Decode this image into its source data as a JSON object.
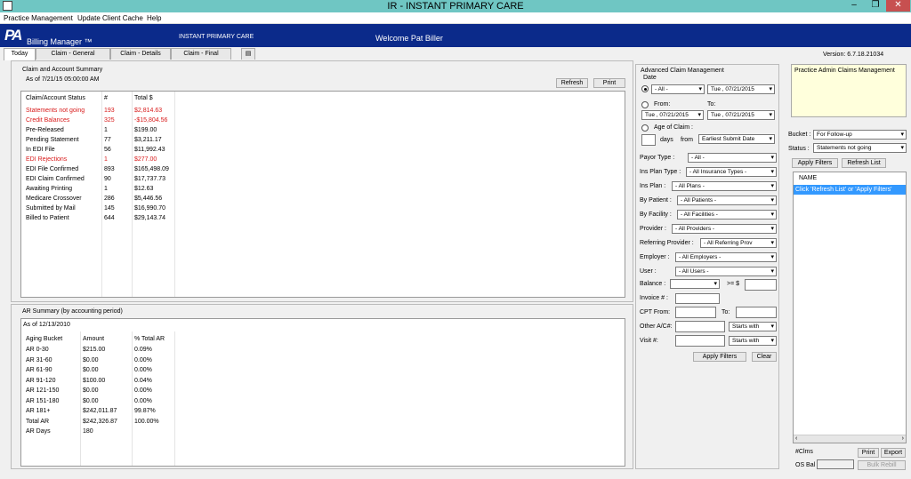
{
  "window": {
    "title": "IR - INSTANT PRIMARY CARE"
  },
  "menu": [
    "Practice Management",
    "Update Client Cache",
    "Help"
  ],
  "banner": {
    "logo": "PA",
    "app_name": "Billing Manager ™",
    "practice": "INSTANT PRIMARY CARE",
    "welcome": "Welcome Pat Biller"
  },
  "tabs": [
    "Today",
    "Claim - General",
    "Claim - Details",
    "Claim - Final"
  ],
  "version": "Version: 6.7.18.21034",
  "summary": {
    "title": "Claim and Account Summary",
    "as_of": "As of 7/21/15 05:00:00 AM",
    "refresh": "Refresh",
    "print": "Print",
    "headers": [
      "Claim/Account Status",
      "#",
      "Total $"
    ],
    "rows": [
      {
        "status": "Statements not going",
        "count": "193",
        "total": "$2,814.63",
        "red": true
      },
      {
        "status": "Credit Balances",
        "count": "325",
        "total": "-$15,804.56",
        "red": true
      },
      {
        "status": "Pre-Released",
        "count": "1",
        "total": "$199.00"
      },
      {
        "status": "Pending Statement",
        "count": "77",
        "total": "$3,211.17"
      },
      {
        "status": "In EDI File",
        "count": "56",
        "total": "$11,992.43"
      },
      {
        "status": "EDI Rejections",
        "count": "1",
        "total": "$277.00",
        "red": true
      },
      {
        "status": "EDI File Confirmed",
        "count": "893",
        "total": "$165,498.09"
      },
      {
        "status": "EDI Claim Confirmed",
        "count": "90",
        "total": "$17,737.73"
      },
      {
        "status": "Awaiting Printing",
        "count": "1",
        "total": "$12.63"
      },
      {
        "status": "Medicare Crossover",
        "count": "286",
        "total": "$5,446.56"
      },
      {
        "status": "Submitted by Mail",
        "count": "145",
        "total": "$16,990.70"
      },
      {
        "status": "Billed to Patient",
        "count": "644",
        "total": "$29,143.74"
      }
    ]
  },
  "ar": {
    "title": "AR Summary (by accounting period)",
    "as_of": "As of 12/13/2010",
    "headers": [
      "Aging Bucket",
      "Amount",
      "% Total AR"
    ],
    "rows": [
      {
        "bucket": "AR 0-30",
        "amount": "$215.00",
        "pct": "0.09%"
      },
      {
        "bucket": "AR 31-60",
        "amount": "$0.00",
        "pct": "0.00%"
      },
      {
        "bucket": "AR 61-90",
        "amount": "$0.00",
        "pct": "0.00%"
      },
      {
        "bucket": "AR 91-120",
        "amount": "$100.00",
        "pct": "0.04%"
      },
      {
        "bucket": "AR 121-150",
        "amount": "$0.00",
        "pct": "0.00%"
      },
      {
        "bucket": "AR 151-180",
        "amount": "$0.00",
        "pct": "0.00%"
      },
      {
        "bucket": "AR 181+",
        "amount": "$242,011.87",
        "pct": "99.87%"
      },
      {
        "bucket": "Total AR",
        "amount": "$242,326.87",
        "pct": "100.00%"
      },
      {
        "bucket": "AR Days",
        "amount": "180",
        "pct": ""
      }
    ]
  },
  "acm": {
    "title": "Advanced Claim Management",
    "date_label": "Date",
    "all": "- All -",
    "date1": "Tue , 07/21/2015",
    "from": "From:",
    "to": "To:",
    "from_date": "Tue , 07/21/2015",
    "to_date": "Tue , 07/21/2015",
    "age_label": "Age of Claim :",
    "days": "days",
    "from2": "from",
    "earliest": "Earliest Submit Date",
    "filters": [
      {
        "label": "Payor Type :",
        "value": "- All -"
      },
      {
        "label": "Ins Plan Type :",
        "value": "- All Insurance Types -"
      },
      {
        "label": "Ins Plan :",
        "value": "- All Plans -"
      },
      {
        "label": "By Patient :",
        "value": "- All Patients -"
      },
      {
        "label": "By Facility :",
        "value": "- All Facilities -"
      },
      {
        "label": "Provider :",
        "value": "- All Providers -"
      },
      {
        "label": "Referring Provider :",
        "value": "- All Referring Prov"
      },
      {
        "label": "Employer :",
        "value": "- All Employers -"
      },
      {
        "label": "User :",
        "value": "- All Users -"
      }
    ],
    "balance": "Balance :",
    "gte": ">= $",
    "invoice": "Invoice # :",
    "cpt_from": "CPT From:",
    "cpt_to": "To:",
    "other": "Other A/C#:",
    "visit": "Visit #:",
    "starts_with": "Starts with",
    "apply": "Apply Filters",
    "clear": "Clear"
  },
  "right": {
    "note": "Practice Admin Claims Management",
    "bucket_label": "Bucket :",
    "bucket": "For Follow-up",
    "status_label": "Status :",
    "status": "Statements not going",
    "apply": "Apply Filters",
    "refresh": "Refresh List",
    "col_name": "NAME",
    "hint": "Click 'Refresh List' or 'Apply Filters'",
    "clms": "#Clms",
    "osbal": "OS Bal",
    "print": "Print",
    "export": "Export",
    "bulk": "Bulk Rebill"
  }
}
